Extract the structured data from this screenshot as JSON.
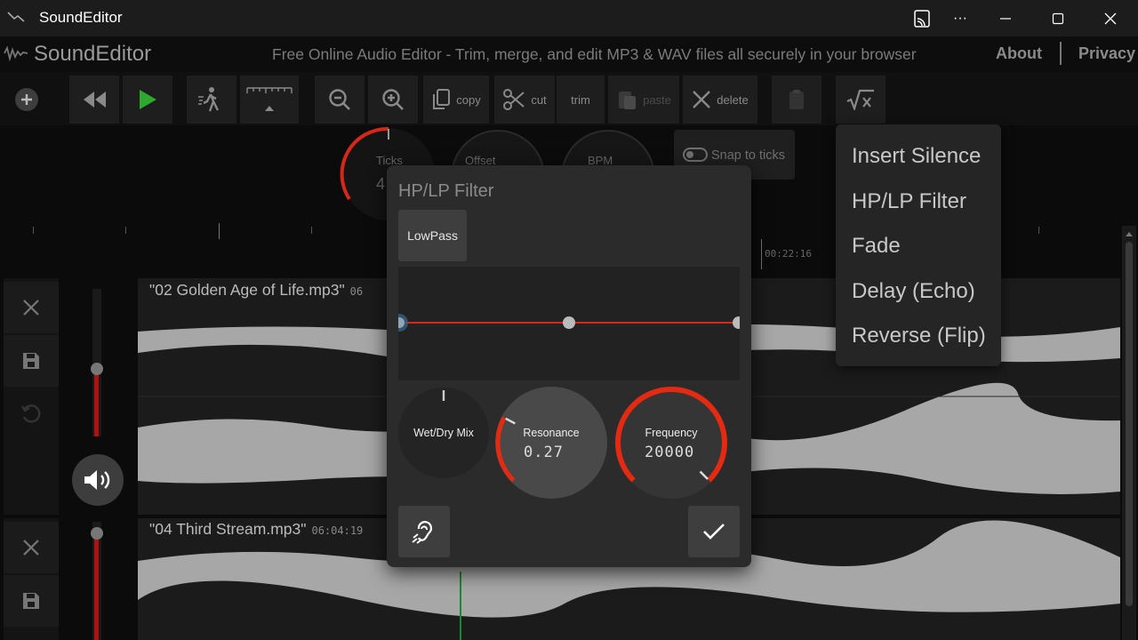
{
  "window": {
    "title": "SoundEditor",
    "controls": [
      "cast-icon",
      "more-icon",
      "minimize-icon",
      "maximize-icon",
      "close-icon"
    ]
  },
  "header": {
    "brand": "SoundEditor",
    "tagline": "Free Online Audio Editor - Trim, merge, and edit MP3 & WAV files all securely in your browser",
    "nav": [
      "About",
      "Privacy"
    ]
  },
  "toolbar": {
    "copy": "copy",
    "cut": "cut",
    "trim": "trim",
    "paste": "paste",
    "delete": "delete"
  },
  "dials": {
    "ticks_label": "Ticks",
    "ticks_value": "4",
    "offset_label": "Offset",
    "bpm_label": "BPM",
    "snap_label": "Snap to ticks"
  },
  "ruler": {
    "time": "00:22:16"
  },
  "tracks": [
    {
      "name": "\"02 Golden Age of Life.mp3\"",
      "duration": "06"
    },
    {
      "name": "\"04 Third Stream.mp3\"",
      "duration": "06:04:19"
    }
  ],
  "menu": {
    "items": [
      "Insert Silence",
      "HP/LP Filter",
      "Fade",
      "Delay (Echo)",
      "Reverse (Flip)"
    ]
  },
  "dialog": {
    "title": "HP/LP Filter",
    "mode": "LowPass",
    "knobs": {
      "wetdry": {
        "label": "Wet/Dry Mix",
        "value": 0.5
      },
      "resonance": {
        "label": "Resonance",
        "value": "0.27",
        "level": 0.27
      },
      "frequency": {
        "label": "Frequency",
        "value": "20000",
        "level": 1.0
      }
    }
  },
  "colors": {
    "accent": "#e52a12",
    "fader": "#b01212",
    "waveform": "#a7a7a7",
    "playhead": "#1a8a2a"
  }
}
